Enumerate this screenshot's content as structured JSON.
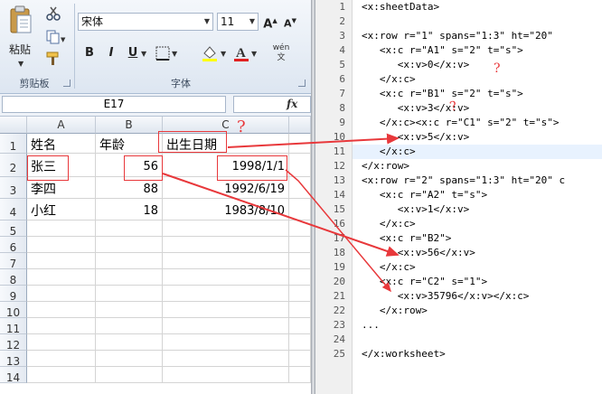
{
  "ribbon": {
    "clipboard": {
      "paste_label": "粘贴",
      "group_label": "剪贴板"
    },
    "font": {
      "font_name": "宋体",
      "font_size": "11",
      "group_label": "字体",
      "bold": "B",
      "italic": "I",
      "underline": "U",
      "phonetic": "wén 文"
    }
  },
  "formula_bar": {
    "name_box": "E17",
    "fx": "fx"
  },
  "sheet": {
    "columns": [
      "A",
      "B",
      "C"
    ],
    "rows": [
      "1",
      "2",
      "3",
      "4",
      "5",
      "6",
      "7",
      "8",
      "9",
      "10",
      "11",
      "12",
      "13",
      "14"
    ],
    "cells": [
      [
        "姓名",
        "年龄",
        "出生日期"
      ],
      [
        "张三",
        "56",
        "1998/1/1"
      ],
      [
        "李四",
        "88",
        "1992/6/19"
      ],
      [
        "小红",
        "18",
        "1983/8/10"
      ]
    ]
  },
  "annotations": {
    "question_mark": "?"
  },
  "editor": {
    "lines": [
      {
        "n": "1",
        "text": "<x:sheetData>"
      },
      {
        "n": "2",
        "text": ""
      },
      {
        "n": "3",
        "text": "<x:row r=\"1\" spans=\"1:3\" ht=\"20\""
      },
      {
        "n": "4",
        "text": "   <x:c r=\"A1\" s=\"2\" t=\"s\">"
      },
      {
        "n": "5",
        "text": "      <x:v>0</x:v>"
      },
      {
        "n": "6",
        "text": "   </x:c>"
      },
      {
        "n": "7",
        "text": "   <x:c r=\"B1\" s=\"2\" t=\"s\">"
      },
      {
        "n": "8",
        "text": "      <x:v>3</x:v>"
      },
      {
        "n": "9",
        "text": "   </x:c><x:c r=\"C1\" s=\"2\" t=\"s\">"
      },
      {
        "n": "10",
        "text": "      <x:v>5</x:v>"
      },
      {
        "n": "11",
        "text": "   </x:c>"
      },
      {
        "n": "12",
        "text": "</x:row>"
      },
      {
        "n": "13",
        "text": "<x:row r=\"2\" spans=\"1:3\" ht=\"20\" c"
      },
      {
        "n": "14",
        "text": "   <x:c r=\"A2\" t=\"s\">"
      },
      {
        "n": "15",
        "text": "      <x:v>1</x:v>"
      },
      {
        "n": "16",
        "text": "   </x:c>"
      },
      {
        "n": "17",
        "text": "   <x:c r=\"B2\">"
      },
      {
        "n": "18",
        "text": "      <x:v>56</x:v>"
      },
      {
        "n": "19",
        "text": "   </x:c>"
      },
      {
        "n": "20",
        "text": "   <x:c r=\"C2\" s=\"1\">"
      },
      {
        "n": "21",
        "text": "      <x:v>35796</x:v></x:c>"
      },
      {
        "n": "22",
        "text": "   </x:row>"
      },
      {
        "n": "23",
        "text": "..."
      },
      {
        "n": "24",
        "text": ""
      },
      {
        "n": "25",
        "text": "</x:worksheet>"
      }
    ]
  },
  "colors": {
    "annotation_red": "#e8383b",
    "current_line": "#e8f2fe"
  }
}
